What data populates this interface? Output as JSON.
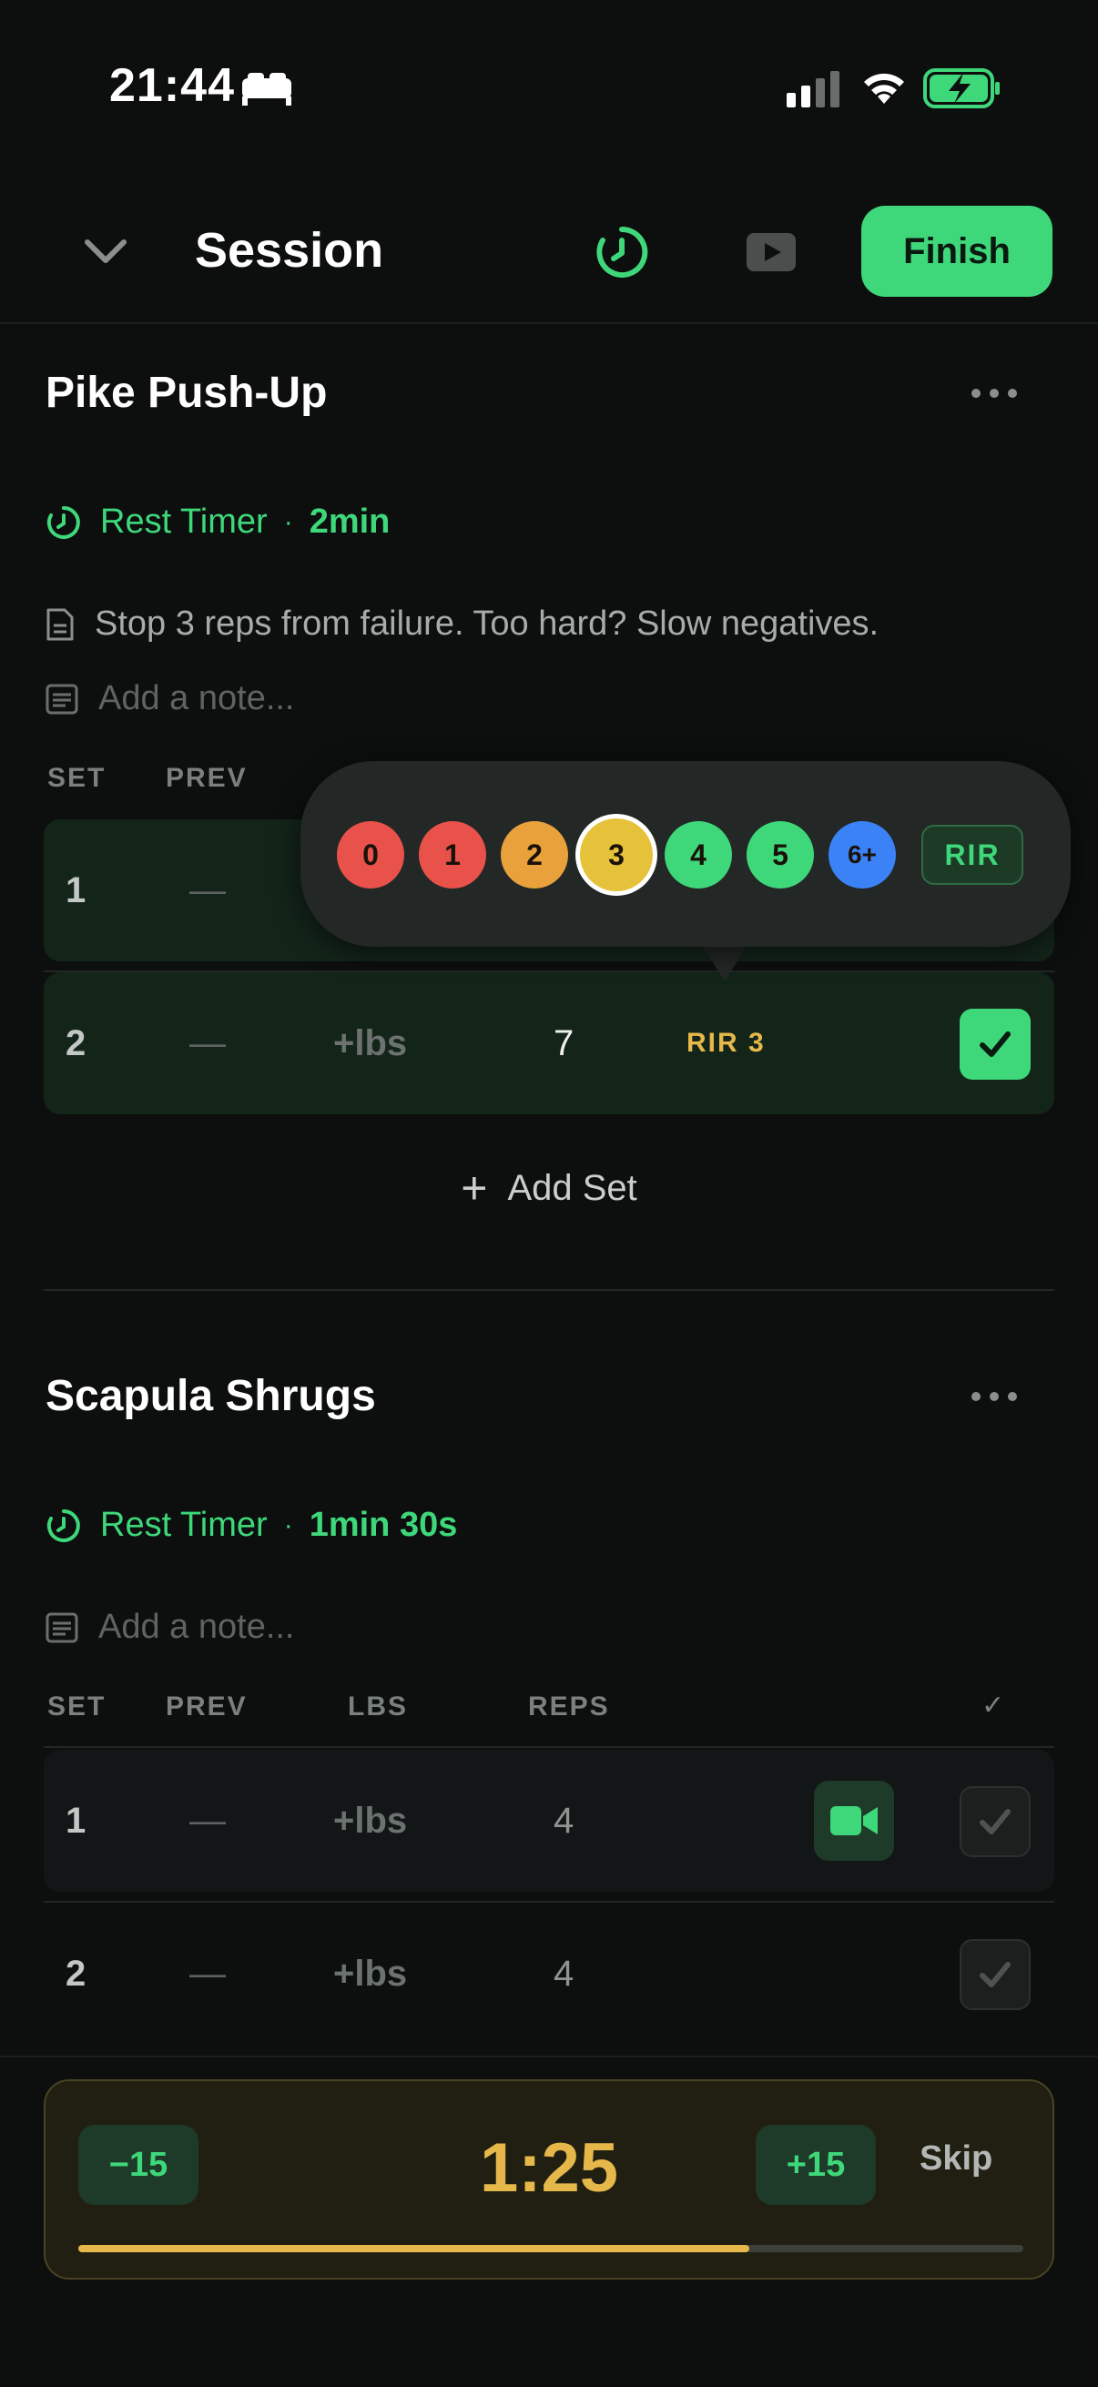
{
  "status_bar": {
    "time": "21:44"
  },
  "header": {
    "title": "Session",
    "finish_label": "Finish"
  },
  "columns": {
    "set": "SET",
    "prev": "PREV",
    "lbs": "LBS",
    "reps": "REPS",
    "check": "✓"
  },
  "exercises": [
    {
      "name": "Pike Push-Up",
      "rest_label": "Rest Timer",
      "rest_separator": "·",
      "rest_value": "2min",
      "note": "Stop 3 reps from failure. Too hard? Slow negatives.",
      "note_placeholder": "Add a note...",
      "sets": [
        {
          "set": "1",
          "prev": "—"
        },
        {
          "set": "2",
          "prev": "—",
          "lbs": "+lbs",
          "reps": "7",
          "rir": "RIR 3"
        }
      ],
      "add_set_label": "Add Set"
    },
    {
      "name": "Scapula Shrugs",
      "rest_label": "Rest Timer",
      "rest_separator": "·",
      "rest_value": "1min 30s",
      "note_placeholder": "Add a note...",
      "sets": [
        {
          "set": "1",
          "prev": "—",
          "lbs": "+lbs",
          "reps": "4"
        },
        {
          "set": "2",
          "prev": "—",
          "lbs": "+lbs",
          "reps": "4"
        }
      ]
    }
  ],
  "rir_picker": {
    "options": [
      {
        "label": "0",
        "color": "#e8524a"
      },
      {
        "label": "1",
        "color": "#e8524a"
      },
      {
        "label": "2",
        "color": "#e9a23b"
      },
      {
        "label": "3",
        "color": "#e6c23a"
      },
      {
        "label": "4",
        "color": "#3ed77a"
      },
      {
        "label": "5",
        "color": "#3ed77a"
      },
      {
        "label": "6+",
        "color": "#3b82f6"
      }
    ],
    "selected": "3",
    "label": "RIR"
  },
  "rest_timer": {
    "minus_label": "−15",
    "plus_label": "+15",
    "time": "1:25",
    "skip_label": "Skip",
    "progress": 0.71
  },
  "colors": {
    "accent": "#3ed77a",
    "timer": "#e6b84a",
    "background": "#0c0f0e"
  }
}
